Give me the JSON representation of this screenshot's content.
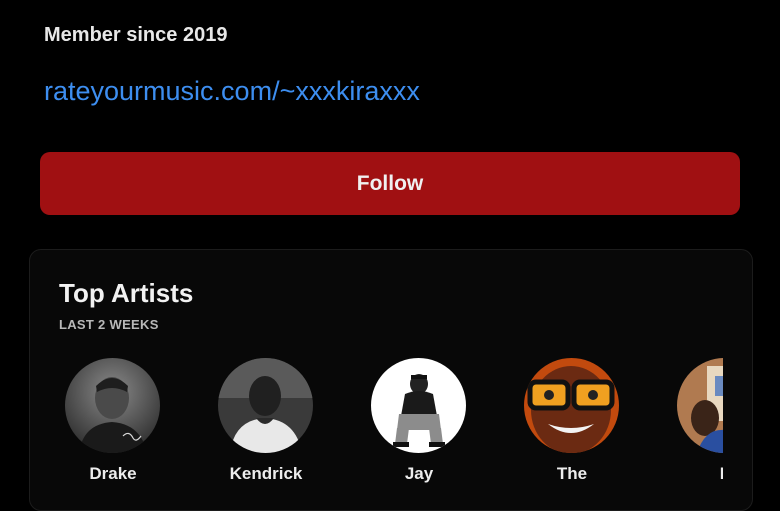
{
  "profile": {
    "member_since": "Member since 2019",
    "link": "rateyourmusic.com/~xxxkiraxxx"
  },
  "actions": {
    "follow_label": "Follow"
  },
  "top_artists": {
    "title": "Top Artists",
    "period": "LAST 2 WEEKS",
    "artists": [
      {
        "name": "Drake"
      },
      {
        "name": "Kendrick"
      },
      {
        "name": "Jay"
      },
      {
        "name": "The"
      },
      {
        "name": "F"
      }
    ]
  }
}
